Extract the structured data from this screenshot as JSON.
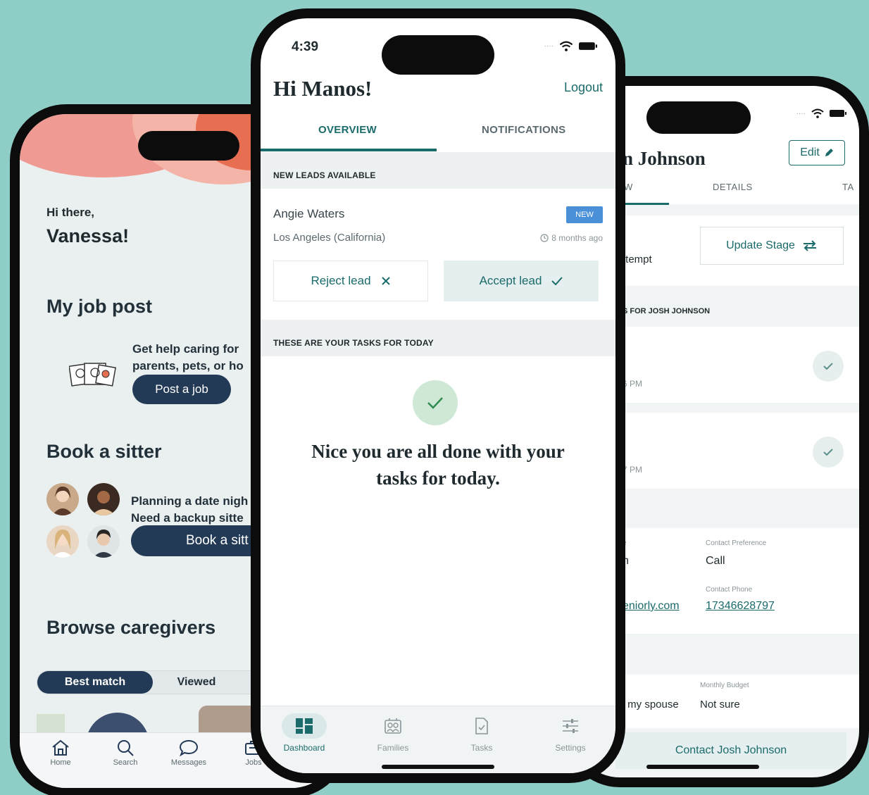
{
  "left_phone": {
    "greeting_small": "Hi there,",
    "greeting_name": "Vanessa!",
    "job_post_title": "My job post",
    "job_post_text": "Get help caring for \nparents, pets, or ho",
    "post_job_label": "Post a job",
    "book_sitter_title": "Book a sitter",
    "sitter_text": "Planning a date nigh\nNeed a backup sitte",
    "book_sitter_button": "Book a sitt",
    "browse_title": "Browse caregivers",
    "segments": {
      "active": "Best match",
      "inactive": "Viewed"
    },
    "tabbar": [
      {
        "label": "Home",
        "icon": "home-icon"
      },
      {
        "label": "Search",
        "icon": "search-icon"
      },
      {
        "label": "Messages",
        "icon": "chat-bubble-icon"
      },
      {
        "label": "Jobs",
        "icon": "briefcase-icon"
      }
    ]
  },
  "center_phone": {
    "status": {
      "time": "4:39"
    },
    "greeting": "Hi Manos!",
    "logout_label": "Logout",
    "tabs": [
      {
        "label": "OVERVIEW",
        "active": true
      },
      {
        "label": "NOTIFICATIONS",
        "active": false
      }
    ],
    "leads_header": "NEW LEADS AVAILABLE",
    "lead": {
      "name": "Angie Waters",
      "location": "Los Angeles (California)",
      "badge": "NEW",
      "age": "8 months ago"
    },
    "reject_label": "Reject lead",
    "accept_label": "Accept lead",
    "tasks_header": "THESE ARE YOUR TASKS FOR TODAY",
    "done_message": "Nice you are all done with your\ntasks for today.",
    "tabbar": [
      {
        "label": "Dashboard",
        "icon": "dashboard-icon",
        "active": true
      },
      {
        "label": "Families",
        "icon": "families-icon",
        "active": false
      },
      {
        "label": "Tasks",
        "icon": "tasks-icon",
        "active": false
      },
      {
        "label": "Settings",
        "icon": "settings-sliders-icon",
        "active": false
      }
    ]
  },
  "right_phone": {
    "name": "n Johnson",
    "edit_label": "Edit",
    "tabs": [
      {
        "label": "W"
      },
      {
        "label": "DETAILS"
      },
      {
        "label": "TA"
      }
    ],
    "stage_text": "ttempt",
    "update_stage_label": "Update Stage",
    "tasks_header": "S FOR JOSH JOHNSON",
    "task_times": [
      "6 PM",
      "7 PM"
    ],
    "contact": {
      "pref_label": "Contact Preference",
      "pref_value": "Call",
      "phone_label": "Contact Phone",
      "phone_value": "17346628797",
      "email_fragment": "eniorly.com",
      "left_fragment_1": "e",
      "left_fragment_2": "h"
    },
    "budget_label": "Monthly Budget",
    "budget_value": "Not sure",
    "relation_fragment": "r my spouse",
    "contact_button": "Contact Josh Johnson"
  },
  "colors": {
    "background": "#8fcec6",
    "teal_accent": "#1a6b6a",
    "navy_button": "#233a56",
    "new_badge": "#4a90d9"
  }
}
